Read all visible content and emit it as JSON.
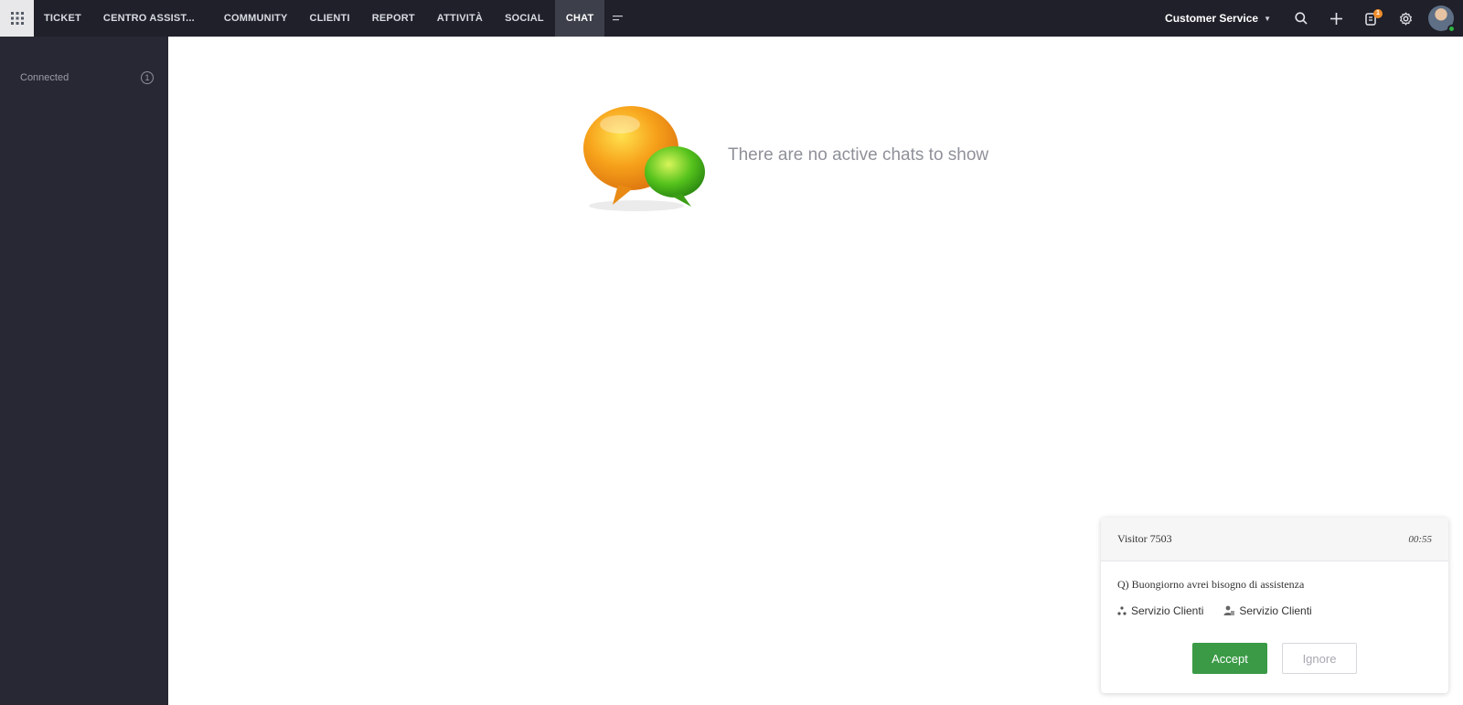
{
  "nav": {
    "tabs": [
      {
        "label": "TICKET"
      },
      {
        "label": "CENTRO ASSIST..."
      },
      {
        "label": "COMMUNITY"
      },
      {
        "label": "CLIENTI"
      },
      {
        "label": "REPORT"
      },
      {
        "label": "ATTIVITÀ"
      },
      {
        "label": "SOCIAL"
      },
      {
        "label": "CHAT"
      }
    ],
    "active_tab": "CHAT",
    "department": "Customer Service",
    "notification_count": "1",
    "icons": [
      "apps-grid-icon",
      "more-tabs-icon",
      "search-icon",
      "plus-icon",
      "notifications-icon",
      "settings-icon",
      "avatar"
    ]
  },
  "sidebar": {
    "status_label": "Connected",
    "status_count": "1"
  },
  "main": {
    "empty_message": "There are no active chats to show"
  },
  "chat_request": {
    "visitor": "Visitor 7503",
    "elapsed": "00:55",
    "question": "Q) Buongiorno avrei bisogno di assistenza",
    "department": "Servizio Clienti",
    "group": "Servizio Clienti",
    "accept_label": "Accept",
    "ignore_label": "Ignore",
    "accept_color": "#3a9a45"
  }
}
